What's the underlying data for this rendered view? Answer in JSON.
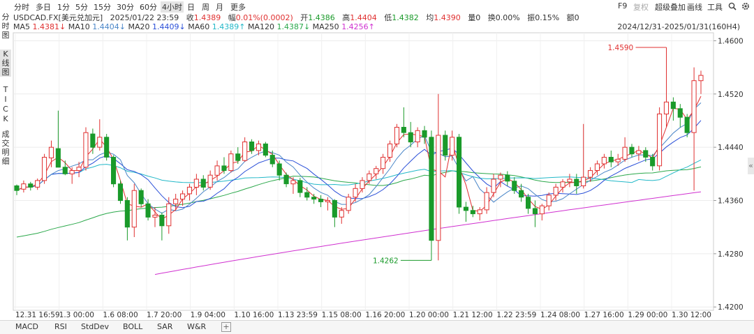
{
  "timeframes": [
    {
      "label": "分时",
      "active": false
    },
    {
      "label": "多日",
      "active": false
    },
    {
      "label": "1分",
      "active": false
    },
    {
      "label": "5分",
      "active": false
    },
    {
      "label": "15分",
      "active": false
    },
    {
      "label": "30分",
      "active": false
    },
    {
      "label": "60分",
      "active": false
    },
    {
      "label": "4小时",
      "active": true
    },
    {
      "label": "日",
      "active": false
    },
    {
      "label": "周",
      "active": false
    },
    {
      "label": "月",
      "active": false
    },
    {
      "label": "更多",
      "active": false
    }
  ],
  "right_tools": [
    {
      "label": "F9",
      "dim": false
    },
    {
      "label": "复权",
      "dim": true
    },
    {
      "label": "超级叠加",
      "dim": false
    },
    {
      "label": "画线",
      "dim": false
    },
    {
      "label": "工具",
      "dim": false
    }
  ],
  "left_nav": {
    "fenshi": [
      "分",
      "时",
      "图"
    ],
    "kline": [
      "K",
      "线",
      "图"
    ],
    "tick": [
      "T",
      "I",
      "C",
      "K"
    ],
    "detail": [
      "成",
      "交",
      "明",
      "细"
    ]
  },
  "info": {
    "symbol": "USDCAD.FX[美元兑加元]",
    "datetime": "2025/01/22 23:59",
    "close_label": "收",
    "close": "1.4389",
    "amp_label": "幅",
    "amp": "0.01%(0.0002)",
    "open_label": "开",
    "open": "1.4386",
    "high_label": "高",
    "high": "1.4404",
    "low_label": "低",
    "low": "1.4382",
    "avg_label": "均",
    "avg": "1.4390",
    "vol_label": "量",
    "vol": "0",
    "turnover_label": "换",
    "turnover": "0.00%",
    "swing_label": "振",
    "swing": "0.15%",
    "amount_label": "额",
    "amount": "0"
  },
  "ma_legend": [
    {
      "name": "MA5",
      "value": "1.4381↓",
      "color": "#e03030"
    },
    {
      "name": "MA10",
      "value": "1.4404↓",
      "color": "#4a86c8"
    },
    {
      "name": "MA20",
      "value": "1.4409↓",
      "color": "#2a4fd8"
    },
    {
      "name": "MA60",
      "value": "1.4389↑",
      "color": "#22b8c8"
    },
    {
      "name": "MA120",
      "value": "1.4387↓",
      "color": "#2aa84a"
    },
    {
      "name": "MA250",
      "value": "1.4256↑",
      "color": "#d030d0"
    }
  ],
  "range_label": "2024/12/31-2025/01/31(160H4)",
  "y_ticks": [
    "1.4600",
    "1.4520",
    "1.4440",
    "1.4360",
    "1.4280",
    "1.4200"
  ],
  "x_ticks": [
    "12.31 16:59",
    "1.3 00:00",
    "1.6 08:00",
    "1.7 20:00",
    "1.9 04:00",
    "1.10 16:00",
    "1.13 23:59",
    "1.15 08:00",
    "1.16 20:00",
    "1.20 00:00",
    "1.21 12:00",
    "1.22 23:59",
    "1.24 08:00",
    "1.27 16:00",
    "1.29 00:00",
    "1.30 12:00"
  ],
  "annotations": {
    "high": "1.4590",
    "low": "1.4262"
  },
  "bottom_tabs": [
    "MACD",
    "RSI",
    "StdDev",
    "BOLL",
    "SAR",
    "W&R"
  ],
  "plus_label": "+",
  "side_toggle": "«",
  "chart_data": {
    "type": "candlestick",
    "y_range": [
      1.4195,
      1.4612
    ],
    "up_color": "#e03030",
    "down_color": "#1a9a2a",
    "series_closes": [
      1.4382,
      1.4378,
      1.4385,
      1.438,
      1.439,
      1.4412,
      1.4432,
      1.442,
      1.44,
      1.4398,
      1.4395,
      1.441,
      1.443,
      1.444,
      1.4448,
      1.4425,
      1.4405,
      1.437,
      1.434,
      1.433,
      1.4345,
      1.436,
      1.434,
      1.433,
      1.4335,
      1.435,
      1.4365,
      1.438,
      1.4375,
      1.4385,
      1.438,
      1.4395,
      1.4405,
      1.44,
      1.4412,
      1.442,
      1.4432,
      1.444,
      1.4435,
      1.4445,
      1.4442,
      1.443,
      1.4418,
      1.4405,
      1.4395,
      1.4385,
      1.4378,
      1.437,
      1.4365,
      1.436,
      1.4352,
      1.4345,
      1.434,
      1.435,
      1.4365,
      1.438,
      1.4392,
      1.44,
      1.4412,
      1.443,
      1.4455,
      1.4475,
      1.4468,
      1.446,
      1.447,
      1.4465,
      1.44,
      1.4345,
      1.444,
      1.4462,
      1.4455,
      1.444,
      1.435,
      1.4345,
      1.4342,
      1.434,
      1.4346,
      1.436,
      1.438,
      1.4392,
      1.4402,
      1.4396,
      1.4385,
      1.437,
      1.4362,
      1.435,
      1.4345,
      1.435,
      1.4355,
      1.4365,
      1.4372,
      1.438,
      1.4382,
      1.4388,
      1.4395,
      1.4402,
      1.4405,
      1.441,
      1.4415,
      1.442,
      1.443,
      1.4425,
      1.4428,
      1.4415,
      1.442,
      1.451,
      1.4495,
      1.448,
      1.4462,
      1.454
    ],
    "candles": [
      [
        1.4382,
        1.4384,
        1.4368,
        1.4375
      ],
      [
        1.4377,
        1.439,
        1.4372,
        1.4385
      ],
      [
        1.4385,
        1.4388,
        1.4375,
        1.438
      ],
      [
        1.438,
        1.4393,
        1.4376,
        1.439
      ],
      [
        1.439,
        1.443,
        1.4385,
        1.4425
      ],
      [
        1.4424,
        1.445,
        1.441,
        1.444
      ],
      [
        1.4438,
        1.4495,
        1.442,
        1.441
      ],
      [
        1.441,
        1.442,
        1.4398,
        1.44
      ],
      [
        1.44,
        1.441,
        1.4385,
        1.4405
      ],
      [
        1.4405,
        1.4418,
        1.4395,
        1.441
      ],
      [
        1.441,
        1.447,
        1.4405,
        1.4462
      ],
      [
        1.446,
        1.4468,
        1.443,
        1.444
      ],
      [
        1.444,
        1.4482,
        1.4435,
        1.4455
      ],
      [
        1.4455,
        1.446,
        1.442,
        1.4425
      ],
      [
        1.4425,
        1.4428,
        1.438,
        1.4385
      ],
      [
        1.4385,
        1.439,
        1.4355,
        1.436
      ],
      [
        1.436,
        1.4365,
        1.43,
        1.432
      ],
      [
        1.432,
        1.4385,
        1.4305,
        1.4375
      ],
      [
        1.4375,
        1.4378,
        1.435,
        1.4355
      ],
      [
        1.4355,
        1.4362,
        1.433,
        1.4335
      ],
      [
        1.4335,
        1.435,
        1.432,
        1.4338
      ],
      [
        1.4338,
        1.4342,
        1.43,
        1.4322
      ],
      [
        1.4322,
        1.4365,
        1.431,
        1.4355
      ],
      [
        1.4355,
        1.437,
        1.4345,
        1.4362
      ],
      [
        1.4362,
        1.4375,
        1.4352,
        1.437
      ],
      [
        1.437,
        1.4385,
        1.436,
        1.438
      ],
      [
        1.438,
        1.44,
        1.4368,
        1.4392
      ],
      [
        1.4392,
        1.4398,
        1.4375,
        1.438
      ],
      [
        1.438,
        1.4405,
        1.4376,
        1.4398
      ],
      [
        1.4398,
        1.442,
        1.439,
        1.4412
      ],
      [
        1.4412,
        1.4425,
        1.44,
        1.4405
      ],
      [
        1.4405,
        1.4435,
        1.4402,
        1.443
      ],
      [
        1.443,
        1.444,
        1.4415,
        1.442
      ],
      [
        1.442,
        1.4455,
        1.4418,
        1.4448
      ],
      [
        1.4448,
        1.4452,
        1.443,
        1.4435
      ],
      [
        1.4435,
        1.445,
        1.4428,
        1.4445
      ],
      [
        1.4445,
        1.4448,
        1.4425,
        1.4428
      ],
      [
        1.4428,
        1.4435,
        1.441,
        1.4415
      ],
      [
        1.4415,
        1.442,
        1.439,
        1.4398
      ],
      [
        1.4398,
        1.4402,
        1.438,
        1.4385
      ],
      [
        1.4385,
        1.4395,
        1.437,
        1.439
      ],
      [
        1.439,
        1.4394,
        1.4365,
        1.4372
      ],
      [
        1.4372,
        1.438,
        1.436,
        1.4365
      ],
      [
        1.4365,
        1.437,
        1.4355,
        1.4362
      ],
      [
        1.4362,
        1.4368,
        1.435,
        1.4358
      ],
      [
        1.4358,
        1.4365,
        1.4345,
        1.436
      ],
      [
        1.436,
        1.4362,
        1.432,
        1.4335
      ],
      [
        1.4335,
        1.435,
        1.4325,
        1.4345
      ],
      [
        1.4345,
        1.437,
        1.434,
        1.4365
      ],
      [
        1.4365,
        1.4385,
        1.4358,
        1.4378
      ],
      [
        1.4378,
        1.4395,
        1.4372,
        1.439
      ],
      [
        1.439,
        1.4405,
        1.4385,
        1.44
      ],
      [
        1.44,
        1.4412,
        1.4392,
        1.4408
      ],
      [
        1.4408,
        1.443,
        1.44,
        1.4425
      ],
      [
        1.4425,
        1.445,
        1.4418,
        1.4445
      ],
      [
        1.4445,
        1.4475,
        1.444,
        1.447
      ],
      [
        1.447,
        1.45,
        1.4455,
        1.4462
      ],
      [
        1.4462,
        1.4478,
        1.444,
        1.4448
      ],
      [
        1.4448,
        1.447,
        1.444,
        1.4465
      ],
      [
        1.4465,
        1.4472,
        1.4445,
        1.4455
      ],
      [
        1.4455,
        1.4465,
        1.427,
        1.43
      ],
      [
        1.43,
        1.452,
        1.427,
        1.4458
      ],
      [
        1.4458,
        1.4465,
        1.442,
        1.4428
      ],
      [
        1.4428,
        1.4465,
        1.442,
        1.4455
      ],
      [
        1.4455,
        1.446,
        1.434,
        1.435
      ],
      [
        1.435,
        1.4358,
        1.4328,
        1.4345
      ],
      [
        1.4345,
        1.4352,
        1.4335,
        1.434
      ],
      [
        1.434,
        1.435,
        1.433,
        1.4346
      ],
      [
        1.4346,
        1.438,
        1.434,
        1.4372
      ],
      [
        1.4372,
        1.44,
        1.4365,
        1.4392
      ],
      [
        1.4392,
        1.4402,
        1.438,
        1.4398
      ],
      [
        1.4398,
        1.4404,
        1.4382,
        1.4389
      ],
      [
        1.4389,
        1.4395,
        1.437,
        1.4375
      ],
      [
        1.4375,
        1.4385,
        1.4358,
        1.4365
      ],
      [
        1.4365,
        1.437,
        1.434,
        1.4348
      ],
      [
        1.4348,
        1.436,
        1.432,
        1.434
      ],
      [
        1.434,
        1.4355,
        1.433,
        1.4352
      ],
      [
        1.4352,
        1.4372,
        1.4345,
        1.4368
      ],
      [
        1.4368,
        1.4385,
        1.436,
        1.438
      ],
      [
        1.438,
        1.4392,
        1.4372,
        1.4388
      ],
      [
        1.4388,
        1.44,
        1.438,
        1.4392
      ],
      [
        1.4392,
        1.44,
        1.437,
        1.4382
      ],
      [
        1.4382,
        1.4475,
        1.4378,
        1.4395
      ],
      [
        1.4395,
        1.441,
        1.4388,
        1.4405
      ],
      [
        1.4405,
        1.442,
        1.4398,
        1.4415
      ],
      [
        1.4415,
        1.443,
        1.4408,
        1.4425
      ],
      [
        1.4425,
        1.4435,
        1.441,
        1.4418
      ],
      [
        1.4418,
        1.443,
        1.4412,
        1.4422
      ],
      [
        1.4422,
        1.4455,
        1.4418,
        1.444
      ],
      [
        1.444,
        1.4445,
        1.4425,
        1.443
      ],
      [
        1.443,
        1.4442,
        1.442,
        1.4435
      ],
      [
        1.4435,
        1.444,
        1.4418,
        1.4425
      ],
      [
        1.4425,
        1.443,
        1.4405,
        1.4412
      ],
      [
        1.4412,
        1.45,
        1.4405,
        1.449
      ],
      [
        1.449,
        1.459,
        1.447,
        1.4508
      ],
      [
        1.4508,
        1.4515,
        1.448,
        1.4498
      ],
      [
        1.4498,
        1.4505,
        1.447,
        1.4485
      ],
      [
        1.4485,
        1.449,
        1.4455,
        1.4462
      ],
      [
        1.4462,
        1.456,
        1.4375,
        1.454
      ],
      [
        1.454,
        1.4555,
        1.452,
        1.4548
      ]
    ]
  }
}
